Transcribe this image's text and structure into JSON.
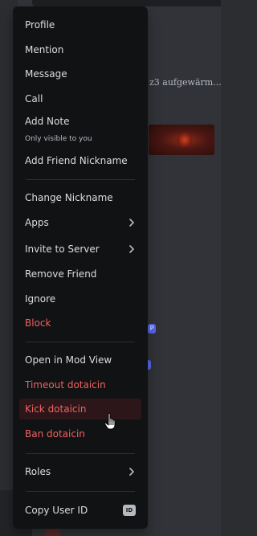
{
  "background": {
    "snippet_text": "z3 aufgewärm..."
  },
  "menu": {
    "profile": "Profile",
    "mention": "Mention",
    "message": "Message",
    "call": "Call",
    "add_note": "Add Note",
    "add_note_sub": "Only visible to you",
    "add_friend_nickname": "Add Friend Nickname",
    "change_nickname": "Change Nickname",
    "apps": "Apps",
    "invite_to_server": "Invite to Server",
    "remove_friend": "Remove Friend",
    "ignore": "Ignore",
    "block": "Block",
    "open_in_mod_view": "Open in Mod View",
    "timeout": "Timeout dotaicin",
    "kick": "Kick dotaicin",
    "ban": "Ban dotaicin",
    "roles": "Roles",
    "copy_user_id": "Copy User ID",
    "id_badge": "ID"
  },
  "colors": {
    "menu_bg": "#111214",
    "text": "#dbdee1",
    "danger": "#f0625f",
    "hover_danger_bg": "#2c1619",
    "separator": "#2e2f34"
  },
  "icons": {
    "submenu": "chevron-right-icon",
    "copy_id": "id-badge-icon",
    "pointer": "hand-pointer-icon"
  }
}
